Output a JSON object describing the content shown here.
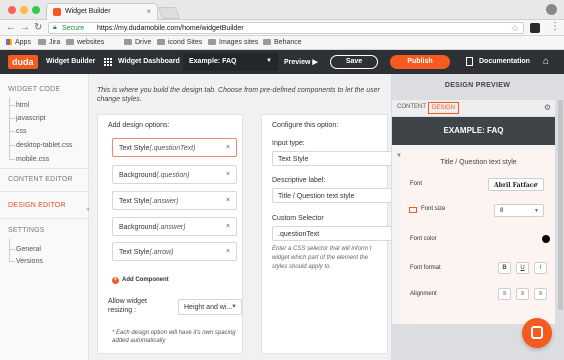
{
  "browser": {
    "tab_title": "Widget Builder",
    "secure_label": "Secure",
    "url": "https://my.dudamobile.com/home/widgetBuilder",
    "bookmarks": [
      "Apps",
      "Jira",
      "websites",
      "Drive",
      "icond Sites",
      "Images sites",
      "Behance"
    ]
  },
  "header": {
    "logo": "duda",
    "widget_builder": "Widget Builder",
    "dashboard": "Widget Dashboard",
    "widget_selector": "Example: FAQ",
    "preview": "Preview",
    "save": "Save",
    "publish": "Publish",
    "documentation": "Documentation"
  },
  "sidebar": {
    "widget_code": "WIDGET CODE",
    "code_files": [
      "html",
      "javascript",
      "css",
      "desktop-tablet.css",
      "mobile.css"
    ],
    "content_editor": "CONTENT EDITOR",
    "design_editor": "DESIGN EDITOR",
    "settings": "SETTINGS",
    "settings_items": [
      "General",
      "Versions"
    ]
  },
  "main": {
    "intro": "This is where you build the design tab. Choose from pre-defined components to let the user change styles.",
    "add_design_options": "Add design options:",
    "options": [
      {
        "label": "Text Style",
        "param": "(.questionText)"
      },
      {
        "label": "Background",
        "param": "(.question)"
      },
      {
        "label": "Text Style",
        "param": "(.answer)"
      },
      {
        "label": "Background",
        "param": "(.answer)"
      },
      {
        "label": "Text Style",
        "param": "(.arrow)"
      }
    ],
    "add_component": "Add Component",
    "allow_resizing": "Allow widget resizing :",
    "resizing_value": "Height and wi...",
    "footnote": "* Each design option will have it's own spacing added automatically",
    "configure_title": "Configure this option:",
    "input_type_label": "Input type:",
    "input_type_value": "Text Style",
    "descriptive_label": "Descriptive label:",
    "descriptive_value": "Title / Question text style",
    "custom_selector_label": "Custom Selector",
    "custom_selector_value": ".questionText",
    "selector_hint_1": "Enter a CSS selector that will inform t",
    "selector_hint_2": "widget which part of the element the",
    "selector_hint_3": "styles should apply to."
  },
  "preview_pane": {
    "title": "DESIGN PREVIEW",
    "tab_content": "CONTENT",
    "tab_design": "DESIGN",
    "header": "EXAMPLE: FAQ",
    "panel_title": "Title / Question text style",
    "font_label": "Font",
    "font_value": "Abril Fatface",
    "font_size_label": "Font size",
    "font_size_value": "8",
    "font_color_label": "Font color",
    "font_color_value": "#000000",
    "font_format_label": "Font format",
    "format_buttons": [
      "B",
      "U",
      "I"
    ],
    "alignment_label": "Alignment"
  },
  "colors": {
    "brand_orange": "#f55a1e",
    "header_dark": "#2d3136",
    "active_sidebar": "#e44d26"
  }
}
